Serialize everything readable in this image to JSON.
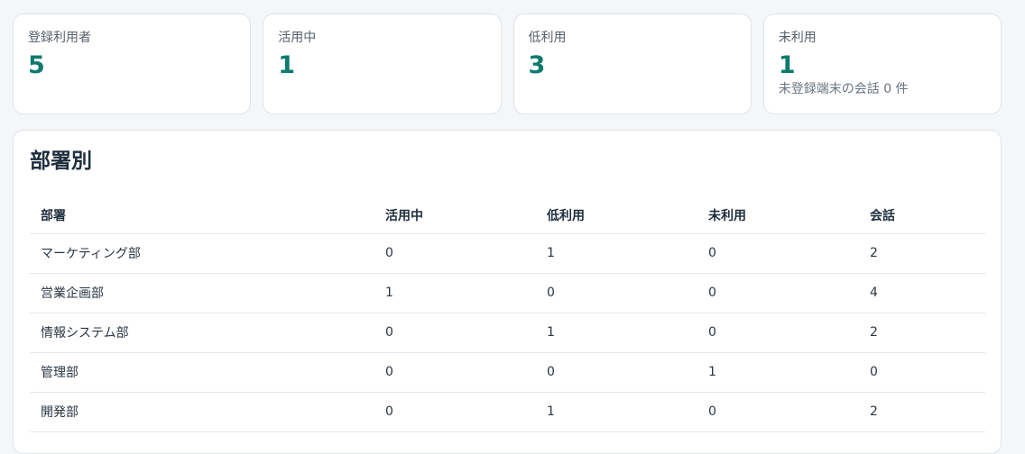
{
  "stats": [
    {
      "label": "登録利用者",
      "value": "5",
      "note": ""
    },
    {
      "label": "活用中",
      "value": "1",
      "note": ""
    },
    {
      "label": "低利用",
      "value": "3",
      "note": ""
    },
    {
      "label": "未利用",
      "value": "1",
      "note": "未登録端末の会話 0 件"
    }
  ],
  "departments": {
    "title": "部署別",
    "columns": [
      "部署",
      "活用中",
      "低利用",
      "未利用",
      "会話"
    ],
    "rows": [
      [
        "マーケティング部",
        "0",
        "1",
        "0",
        "2"
      ],
      [
        "営業企画部",
        "1",
        "0",
        "0",
        "4"
      ],
      [
        "情報システム部",
        "0",
        "1",
        "0",
        "2"
      ],
      [
        "管理部",
        "0",
        "0",
        "1",
        "0"
      ],
      [
        "開発部",
        "0",
        "1",
        "0",
        "2"
      ]
    ]
  },
  "colors": {
    "accent": "#0f7a6e",
    "background": "#f4f6f8",
    "card": "#ffffff",
    "border": "#dfe4ea"
  }
}
